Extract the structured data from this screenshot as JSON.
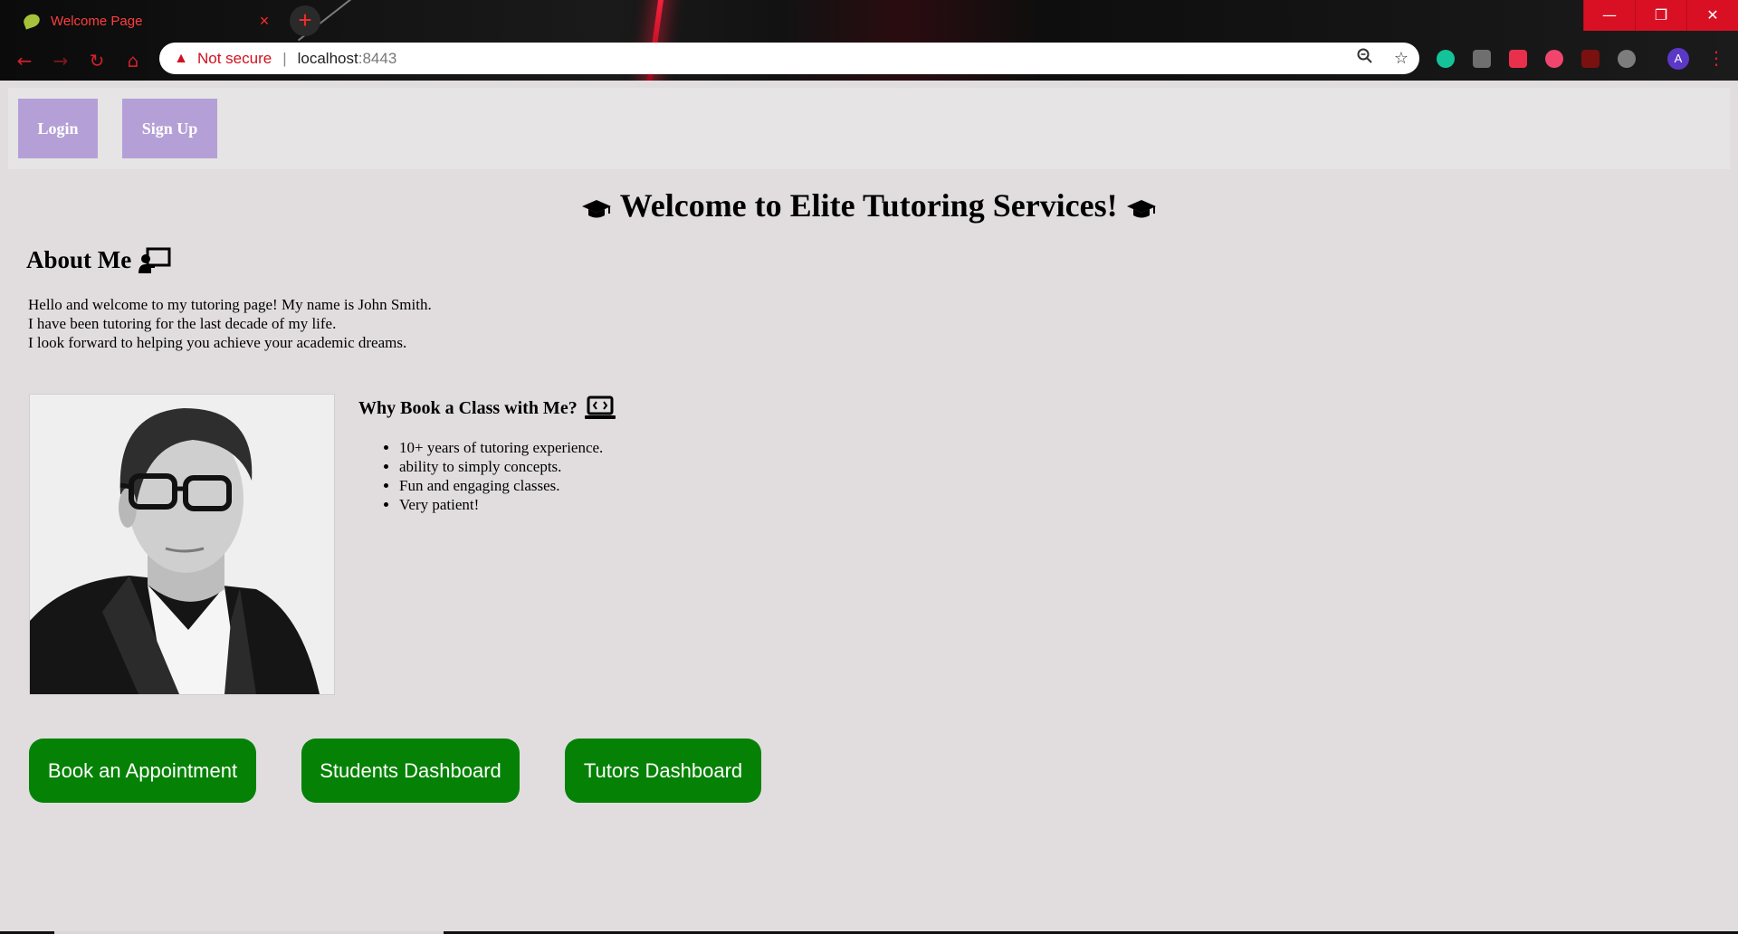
{
  "browser": {
    "tab_title": "Welcome Page",
    "tab_close": "×",
    "new_tab": "+",
    "security_label": "Not secure",
    "url_host": "localhost",
    "url_port": ":8443",
    "avatar_initial": "A",
    "window": {
      "minimize": "—",
      "restore": "❐",
      "close": "✕"
    }
  },
  "nav": {
    "login": "Login",
    "signup": "Sign Up"
  },
  "heading": "Welcome to Elite Tutoring Services!",
  "about": {
    "title": "About Me",
    "lines": [
      "Hello and welcome to my tutoring page! My name is John Smith.",
      "I have been tutoring for the last decade of my life.",
      "I look forward to helping you achieve your academic dreams."
    ]
  },
  "why": {
    "title": "Why Book a Class with Me?",
    "items": [
      "10+ years of tutoring experience.",
      "ability to simply concepts.",
      "Fun and engaging classes.",
      "Very patient!"
    ]
  },
  "actions": {
    "book": "Book an Appointment",
    "students": "Students Dashboard",
    "tutors": "Tutors Dashboard"
  },
  "colors": {
    "page_bg": "#e1dddf",
    "nav_button": "#b4a0d6",
    "action_button": "#058205",
    "browser_accent": "#d91024"
  }
}
